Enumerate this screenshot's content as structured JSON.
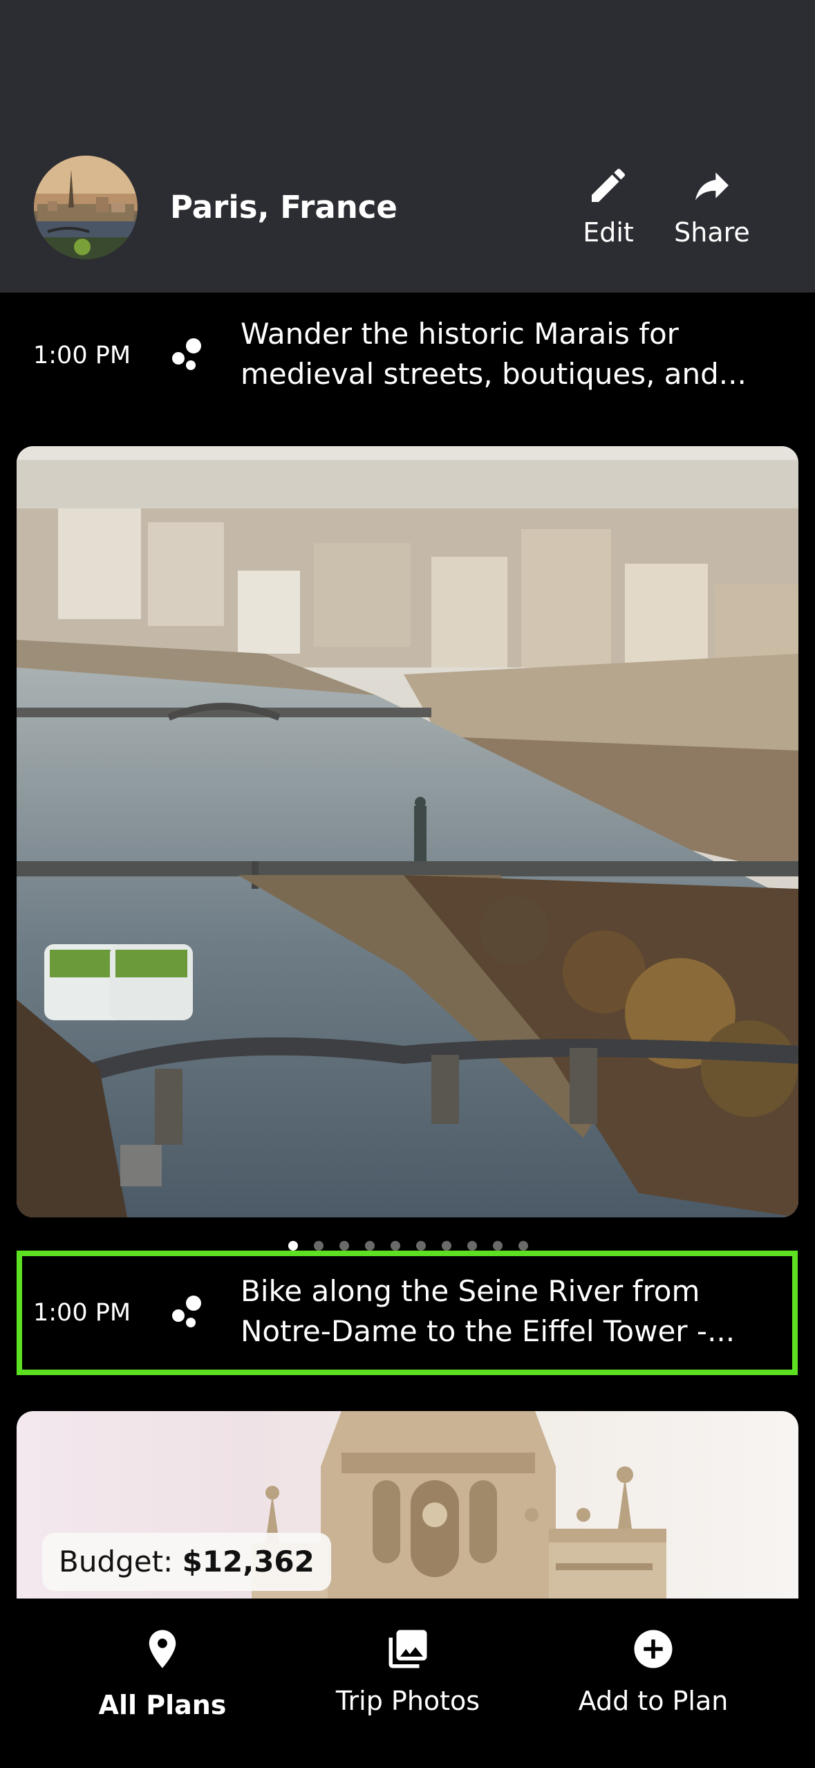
{
  "header": {
    "title": "Paris, France",
    "edit_label": "Edit",
    "share_label": "Share",
    "background": "#2c2d32"
  },
  "activities": [
    {
      "time": "1:00 PM",
      "description_lines": [
        "Wander the historic Marais for",
        "medieval streets, boutiques, and..."
      ],
      "icon": "dots-icon"
    },
    {
      "time": "1:00 PM",
      "description_lines": [
        "Bike along the Seine River from",
        "Notre-Dame to the Eiffel Tower -..."
      ],
      "icon": "dots-icon",
      "highlight_color": "#5ee022"
    }
  ],
  "carousel": {
    "page_count": 10,
    "active_index": 0
  },
  "budget": {
    "label": "Budget:",
    "value": "$12,362"
  },
  "bottom_nav": {
    "items": [
      {
        "label": "All Plans",
        "icon": "map-pin-icon",
        "active": true
      },
      {
        "label": "Trip Photos",
        "icon": "photos-icon",
        "active": false
      },
      {
        "label": "Add to Plan",
        "icon": "plus-circle-icon",
        "active": false
      }
    ]
  }
}
